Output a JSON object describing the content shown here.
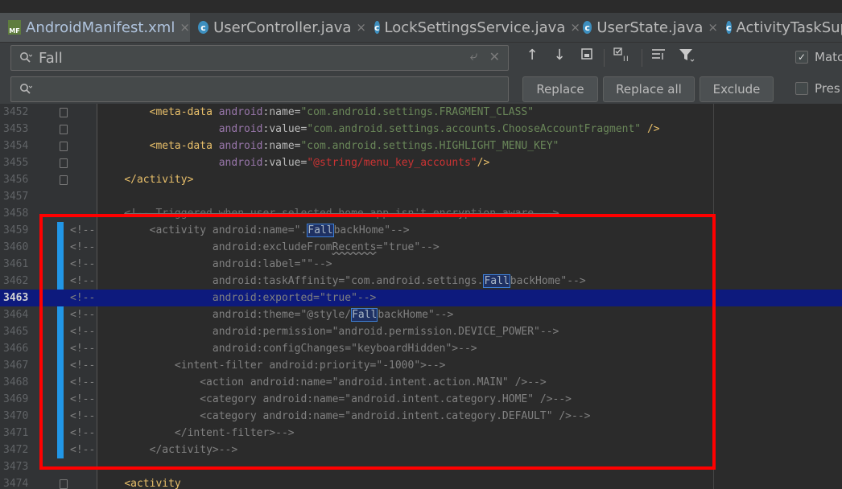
{
  "tabs": [
    {
      "label": "AndroidManifest.xml",
      "icon": "manifest-file-icon",
      "active": true,
      "closable": true
    },
    {
      "label": "UserController.java",
      "icon": "java-class-icon",
      "active": false,
      "closable": true
    },
    {
      "label": "LockSettingsService.java",
      "icon": "java-class-icon",
      "active": false,
      "closable": true
    },
    {
      "label": "UserState.java",
      "icon": "java-class-icon",
      "active": false,
      "closable": true
    },
    {
      "label": "ActivityTaskSup",
      "icon": "java-class-icon",
      "active": false,
      "closable": false
    }
  ],
  "find": {
    "search_value": "Fall",
    "replace_value": "",
    "replace_label": "Replace",
    "replace_all_label": "Replace all",
    "exclude_label": "Exclude",
    "match_case_label": "Matc",
    "match_case_checked": true,
    "preserve_case_label": "Pres",
    "preserve_case_checked": false
  },
  "code_lines": [
    {
      "n": "3452",
      "tokens": [
        [
          "",
          "        "
        ],
        [
          "t",
          "<meta-data "
        ],
        [
          "an",
          "android"
        ],
        [
          "at",
          ":name="
        ],
        [
          "v",
          "\"com.android.settings.FRAGMENT_CLASS\""
        ]
      ]
    },
    {
      "n": "3453",
      "tokens": [
        [
          "",
          "                   "
        ],
        [
          "an",
          "android"
        ],
        [
          "at",
          ":value="
        ],
        [
          "v",
          "\"com.android.settings.accounts.ChooseAccountFragment\""
        ],
        [
          "t",
          " />"
        ]
      ]
    },
    {
      "n": "3454",
      "tokens": [
        [
          "",
          "        "
        ],
        [
          "t",
          "<meta-data "
        ],
        [
          "an",
          "android"
        ],
        [
          "at",
          ":name="
        ],
        [
          "v",
          "\"com.android.settings.HIGHLIGHT_MENU_KEY\""
        ]
      ]
    },
    {
      "n": "3455",
      "tokens": [
        [
          "",
          "                   "
        ],
        [
          "an",
          "android"
        ],
        [
          "at",
          ":value="
        ],
        [
          "rs",
          "\"@string/menu_key_accounts\""
        ],
        [
          "t",
          "/>"
        ]
      ]
    },
    {
      "n": "3456",
      "tokens": [
        [
          "",
          "    "
        ],
        [
          "t",
          "</activity>"
        ]
      ]
    },
    {
      "n": "3457",
      "tokens": []
    },
    {
      "n": "3458",
      "tokens": [
        [
          "",
          "    "
        ],
        [
          "st",
          "<!-- Triggered when user-selected home app isn't encryption aware -->"
        ]
      ]
    },
    {
      "n": "3459",
      "comment": "<!--",
      "tokens": [
        [
          "",
          "        "
        ],
        [
          "g",
          "<activity android:name=\"."
        ],
        [
          "m",
          "Fall"
        ],
        [
          "g",
          "backHome\"-->"
        ]
      ]
    },
    {
      "n": "3460",
      "comment": "<!--",
      "tokens": [
        [
          "",
          "                  "
        ],
        [
          "g",
          "android:excludeFrom"
        ],
        [
          "gsq",
          "Recents"
        ],
        [
          "g",
          "=\"true\"-->"
        ]
      ]
    },
    {
      "n": "3461",
      "comment": "<!--",
      "tokens": [
        [
          "",
          "                  "
        ],
        [
          "g",
          "android:label=\"\"-->"
        ]
      ]
    },
    {
      "n": "3462",
      "comment": "<!--",
      "tokens": [
        [
          "",
          "                  "
        ],
        [
          "g",
          "android:taskAffinity=\"com.android.settings."
        ],
        [
          "m",
          "Fall"
        ],
        [
          "g",
          "backHome\"-->"
        ]
      ]
    },
    {
      "n": "3463",
      "comment": "<!--",
      "hl": true,
      "tokens": [
        [
          "",
          "                  "
        ],
        [
          "g",
          "android:exported=\"true\"-->"
        ]
      ]
    },
    {
      "n": "3464",
      "comment": "<!--",
      "tokens": [
        [
          "",
          "                  "
        ],
        [
          "g",
          "android:theme=\"@style/"
        ],
        [
          "m",
          "Fall"
        ],
        [
          "g",
          "backHome\"-->"
        ]
      ]
    },
    {
      "n": "3465",
      "comment": "<!--",
      "tokens": [
        [
          "",
          "                  "
        ],
        [
          "g",
          "android:permission=\"android.permission.DEVICE_POWER\"-->"
        ]
      ]
    },
    {
      "n": "3466",
      "comment": "<!--",
      "tokens": [
        [
          "",
          "                  "
        ],
        [
          "g",
          "android:configChanges=\"keyboardHidden\">-->"
        ]
      ]
    },
    {
      "n": "3467",
      "comment": "<!--",
      "tokens": [
        [
          "",
          "            "
        ],
        [
          "g",
          "<intent-filter android:priority=\"-1000\">-->"
        ]
      ]
    },
    {
      "n": "3468",
      "comment": "<!--",
      "tokens": [
        [
          "",
          "                "
        ],
        [
          "g",
          "<action android:name=\"android.intent.action.MAIN\" />-->"
        ]
      ]
    },
    {
      "n": "3469",
      "comment": "<!--",
      "tokens": [
        [
          "",
          "                "
        ],
        [
          "g",
          "<category android:name=\"android.intent.category.HOME\" />-->"
        ]
      ]
    },
    {
      "n": "3470",
      "comment": "<!--",
      "tokens": [
        [
          "",
          "                "
        ],
        [
          "g",
          "<category android:name=\"android.intent.category.DEFAULT\" />-->"
        ]
      ]
    },
    {
      "n": "3471",
      "comment": "<!--",
      "tokens": [
        [
          "",
          "            "
        ],
        [
          "g",
          "</intent-filter>-->"
        ]
      ]
    },
    {
      "n": "3472",
      "comment": "<!--",
      "tokens": [
        [
          "",
          "        "
        ],
        [
          "g",
          "</activity>-->"
        ]
      ]
    },
    {
      "n": "3473",
      "tokens": []
    },
    {
      "n": "3474",
      "tokens": [
        [
          "",
          "    "
        ],
        [
          "t",
          "<activity"
        ]
      ]
    }
  ],
  "fold_lines": [
    "3452",
    "3453",
    "3454",
    "3455",
    "3456",
    "3474"
  ],
  "colors": {
    "highlight_row": "#0d1a7d",
    "annotation_box": "#ff0000",
    "change_marker": "#2196e6",
    "match_border": "#3d7fd6"
  }
}
